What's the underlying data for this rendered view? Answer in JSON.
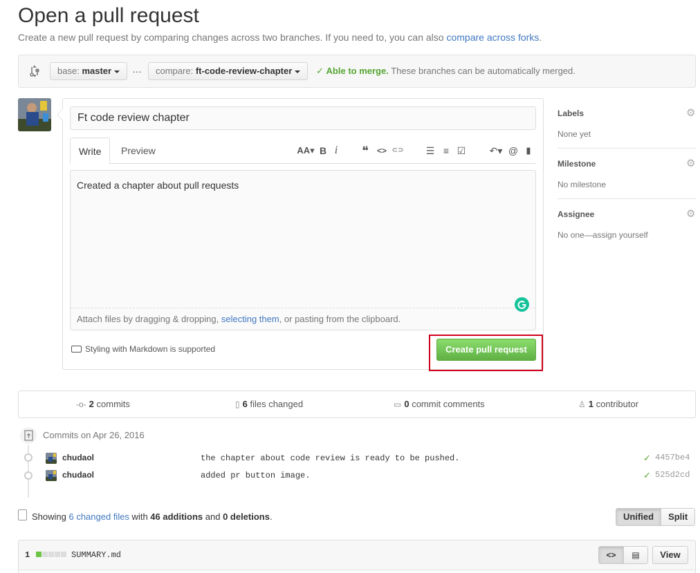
{
  "page": {
    "title": "Open a pull request",
    "subtitle_prefix": "Create a new pull request by comparing changes across two branches. If you need to, you can also ",
    "subtitle_link": "compare across forks",
    "subtitle_suffix": "."
  },
  "range": {
    "base_label": "base:",
    "base_value": "master",
    "ellipsis": "…",
    "compare_label": "compare:",
    "compare_value": "ft-code-review-chapter",
    "merge_check": "✓",
    "merge_status": "Able to merge.",
    "merge_detail": "These branches can be automatically merged."
  },
  "compose": {
    "title_value": "Ft code review chapter",
    "tabs": [
      {
        "label": "Write"
      },
      {
        "label": "Preview"
      }
    ],
    "toolbar": [
      {
        "icon": "text-size-icon",
        "glyph": "AA▾"
      },
      {
        "icon": "bold-icon",
        "glyph": "B"
      },
      {
        "icon": "italic-icon",
        "glyph": "i"
      },
      {
        "icon": "quote-icon",
        "glyph": "❝"
      },
      {
        "icon": "code-icon",
        "glyph": "<>"
      },
      {
        "icon": "link-icon",
        "glyph": "⊂⊃"
      },
      {
        "icon": "unordered-list-icon",
        "glyph": "☰"
      },
      {
        "icon": "ordered-list-icon",
        "glyph": "≡"
      },
      {
        "icon": "task-list-icon",
        "glyph": "☑"
      },
      {
        "icon": "reply-icon",
        "glyph": "↶▾"
      },
      {
        "icon": "mention-icon",
        "glyph": "@"
      },
      {
        "icon": "bookmark-icon",
        "glyph": "▮"
      }
    ],
    "body_value": "Created a chapter about pull requests",
    "attach_prefix": "Attach files by dragging & dropping, ",
    "attach_link": "selecting them",
    "attach_suffix": ", or pasting from the clipboard.",
    "markdown_note": "Styling with Markdown is supported",
    "create_button": "Create pull request"
  },
  "sidebar": {
    "labels_title": "Labels",
    "labels_value": "None yet",
    "milestone_title": "Milestone",
    "milestone_value": "No milestone",
    "assignee_title": "Assignee",
    "assignee_value": "No one—assign yourself"
  },
  "summary": {
    "commits_count": "2",
    "commits_label": "commits",
    "files_count": "6",
    "files_label": "files changed",
    "comments_count": "0",
    "comments_label": "commit comments",
    "contributors_count": "1",
    "contributors_label": "contributor"
  },
  "commits": {
    "header": "Commits on Apr 26, 2016",
    "items": [
      {
        "author": "chudaol",
        "message": "the chapter about code review is ready to be pushed.",
        "sha": "4457be4"
      },
      {
        "author": "chudaol",
        "message": "added pr button image.",
        "sha": "525d2cd"
      }
    ]
  },
  "diff_summary": {
    "prefix": "Showing ",
    "files_link": "6 changed files",
    "middle": " with ",
    "additions": "46 additions",
    "and": " and ",
    "deletions": "0 deletions",
    "suffix": ".",
    "unified": "Unified",
    "split": "Split"
  },
  "file": {
    "count": "1",
    "name": "SUMMARY.md",
    "diffstat": [
      "#6cc644",
      "#ddd",
      "#ddd",
      "#ddd",
      "#ddd"
    ],
    "view_button": "View"
  },
  "colors": {
    "link": "#4078c0",
    "success": "#55a532",
    "create_button": "#60b044",
    "highlight": "#d0021b"
  }
}
